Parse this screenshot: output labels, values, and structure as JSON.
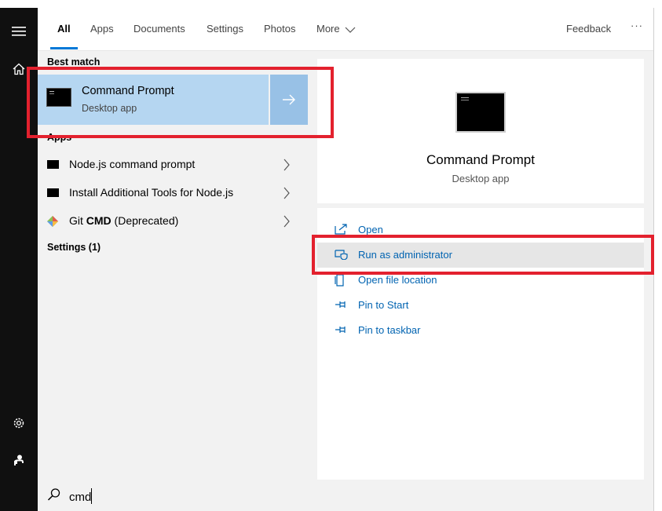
{
  "tabs": [
    {
      "label": "All",
      "active": true
    },
    {
      "label": "Apps"
    },
    {
      "label": "Documents"
    },
    {
      "label": "Settings"
    },
    {
      "label": "Photos"
    },
    {
      "label": "More"
    }
  ],
  "header": {
    "feedback_label": "Feedback",
    "more_options_label": "···"
  },
  "results": {
    "best_match_header": "Best match",
    "best_match": {
      "title": "Command Prompt",
      "subtitle": "Desktop app"
    },
    "apps_header": "Apps",
    "apps": [
      {
        "label": "Node.js command prompt",
        "icon": "console-icon"
      },
      {
        "label": "Install Additional Tools for Node.js",
        "icon": "console-icon"
      },
      {
        "label_prefix": "Git ",
        "label_bold": "CMD",
        "label_suffix": " (Deprecated)",
        "icon": "git-icon"
      }
    ],
    "settings_header": "Settings (1)"
  },
  "details": {
    "title": "Command Prompt",
    "subtitle": "Desktop app",
    "actions": [
      {
        "label": "Open",
        "icon": "open-icon"
      },
      {
        "label": "Run as administrator",
        "icon": "shield-icon"
      },
      {
        "label": "Open file location",
        "icon": "file-location-icon"
      },
      {
        "label": "Pin to Start",
        "icon": "pin-icon"
      },
      {
        "label": "Pin to taskbar",
        "icon": "pin-icon"
      }
    ]
  },
  "search": {
    "value": "cmd"
  },
  "colors": {
    "accent": "#0078d7",
    "selection": "#b5d6f1",
    "highlight_box": "#e3212e",
    "link": "#0063b1"
  }
}
